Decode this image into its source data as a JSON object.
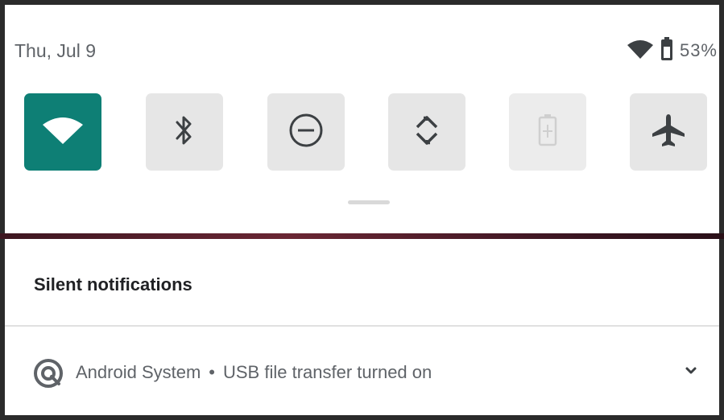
{
  "status_bar": {
    "date": "Thu, Jul 9",
    "battery_percent": "53%",
    "wifi_icon": "wifi-icon",
    "battery_icon": "battery-icon"
  },
  "quick_settings": {
    "tiles": [
      {
        "icon": "wifi-icon",
        "active": true
      },
      {
        "icon": "bluetooth-icon",
        "active": false
      },
      {
        "icon": "do-not-disturb-icon",
        "active": false
      },
      {
        "icon": "auto-rotate-icon",
        "active": false
      },
      {
        "icon": "battery-saver-icon",
        "active": false,
        "disabled": true
      },
      {
        "icon": "airplane-mode-icon",
        "active": false
      }
    ],
    "accent_color": "#0e7f75"
  },
  "notifications": {
    "section_title": "Silent notifications",
    "items": [
      {
        "app_name": "Android System",
        "separator": "•",
        "title": "USB file transfer turned on",
        "icon": "android-system-icon",
        "expand_icon": "chevron-down-icon"
      }
    ]
  }
}
